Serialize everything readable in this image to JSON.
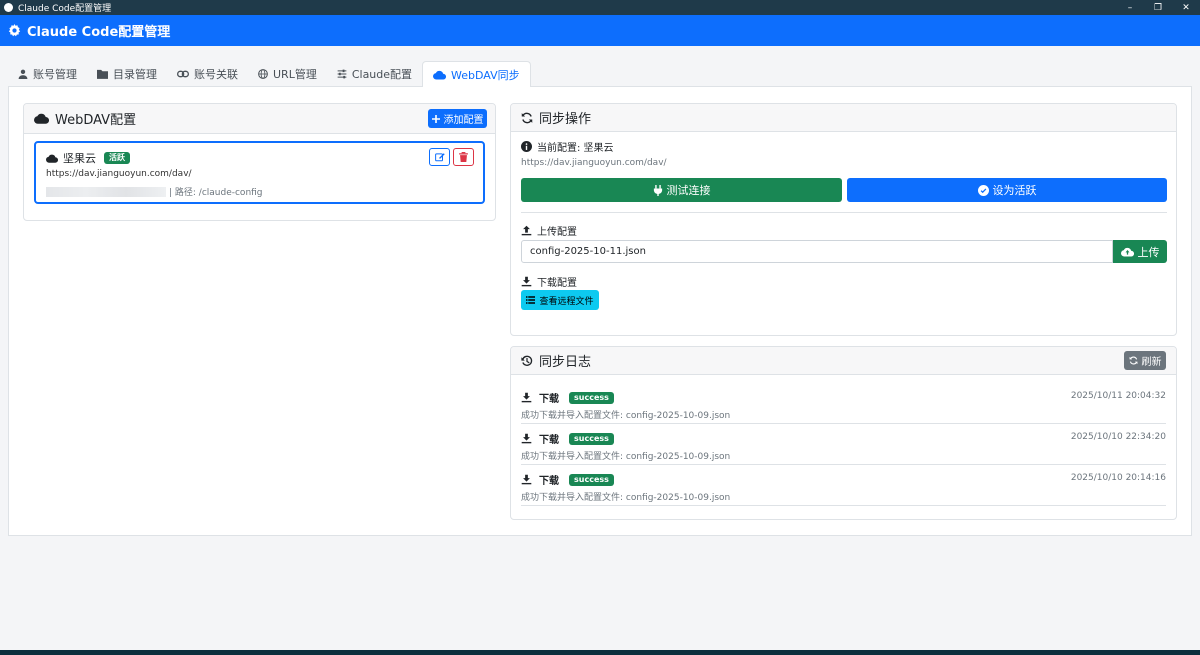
{
  "window": {
    "title": "Claude Code配置管理"
  },
  "header": {
    "title": "Claude Code配置管理"
  },
  "tabs": [
    {
      "label": "账号管理",
      "icon": "user-icon"
    },
    {
      "label": "目录管理",
      "icon": "folder-icon"
    },
    {
      "label": "账号关联",
      "icon": "link-icon"
    },
    {
      "label": "URL管理",
      "icon": "globe-icon"
    },
    {
      "label": "Claude配置",
      "icon": "sliders-icon"
    },
    {
      "label": "WebDAV同步",
      "icon": "cloud-icon",
      "active": true
    }
  ],
  "webdav": {
    "title": "WebDAV配置",
    "add_label": "添加配置",
    "item": {
      "name": "坚果云",
      "badge": "活跃",
      "url": "https://dav.jianguoyun.com/dav/",
      "path": "| 路径: /claude-config"
    }
  },
  "sync": {
    "title": "同步操作",
    "current_label": "当前配置: 坚果云",
    "current_url": "https://dav.jianguoyun.com/dav/",
    "test_label": "测试连接",
    "activate_label": "设为活跃",
    "upload_heading": "上传配置",
    "upload_filename": "config-2025-10-11.json",
    "upload_label": "上传",
    "download_heading": "下载配置",
    "remote_files_label": "查看远程文件"
  },
  "log": {
    "title": "同步日志",
    "refresh_label": "刷新",
    "entries": [
      {
        "action": "下载",
        "status": "success",
        "message": "成功下载并导入配置文件: config-2025-10-09.json",
        "time": "2025/10/11 20:04:32"
      },
      {
        "action": "下载",
        "status": "success",
        "message": "成功下载并导入配置文件: config-2025-10-09.json",
        "time": "2025/10/10 22:34:20"
      },
      {
        "action": "下载",
        "status": "success",
        "message": "成功下载并导入配置文件: config-2025-10-09.json",
        "time": "2025/10/10 20:14:16"
      }
    ]
  },
  "colors": {
    "primary": "#0d6efd",
    "success": "#198754",
    "info": "#0dcaf0",
    "danger": "#dc3545"
  }
}
